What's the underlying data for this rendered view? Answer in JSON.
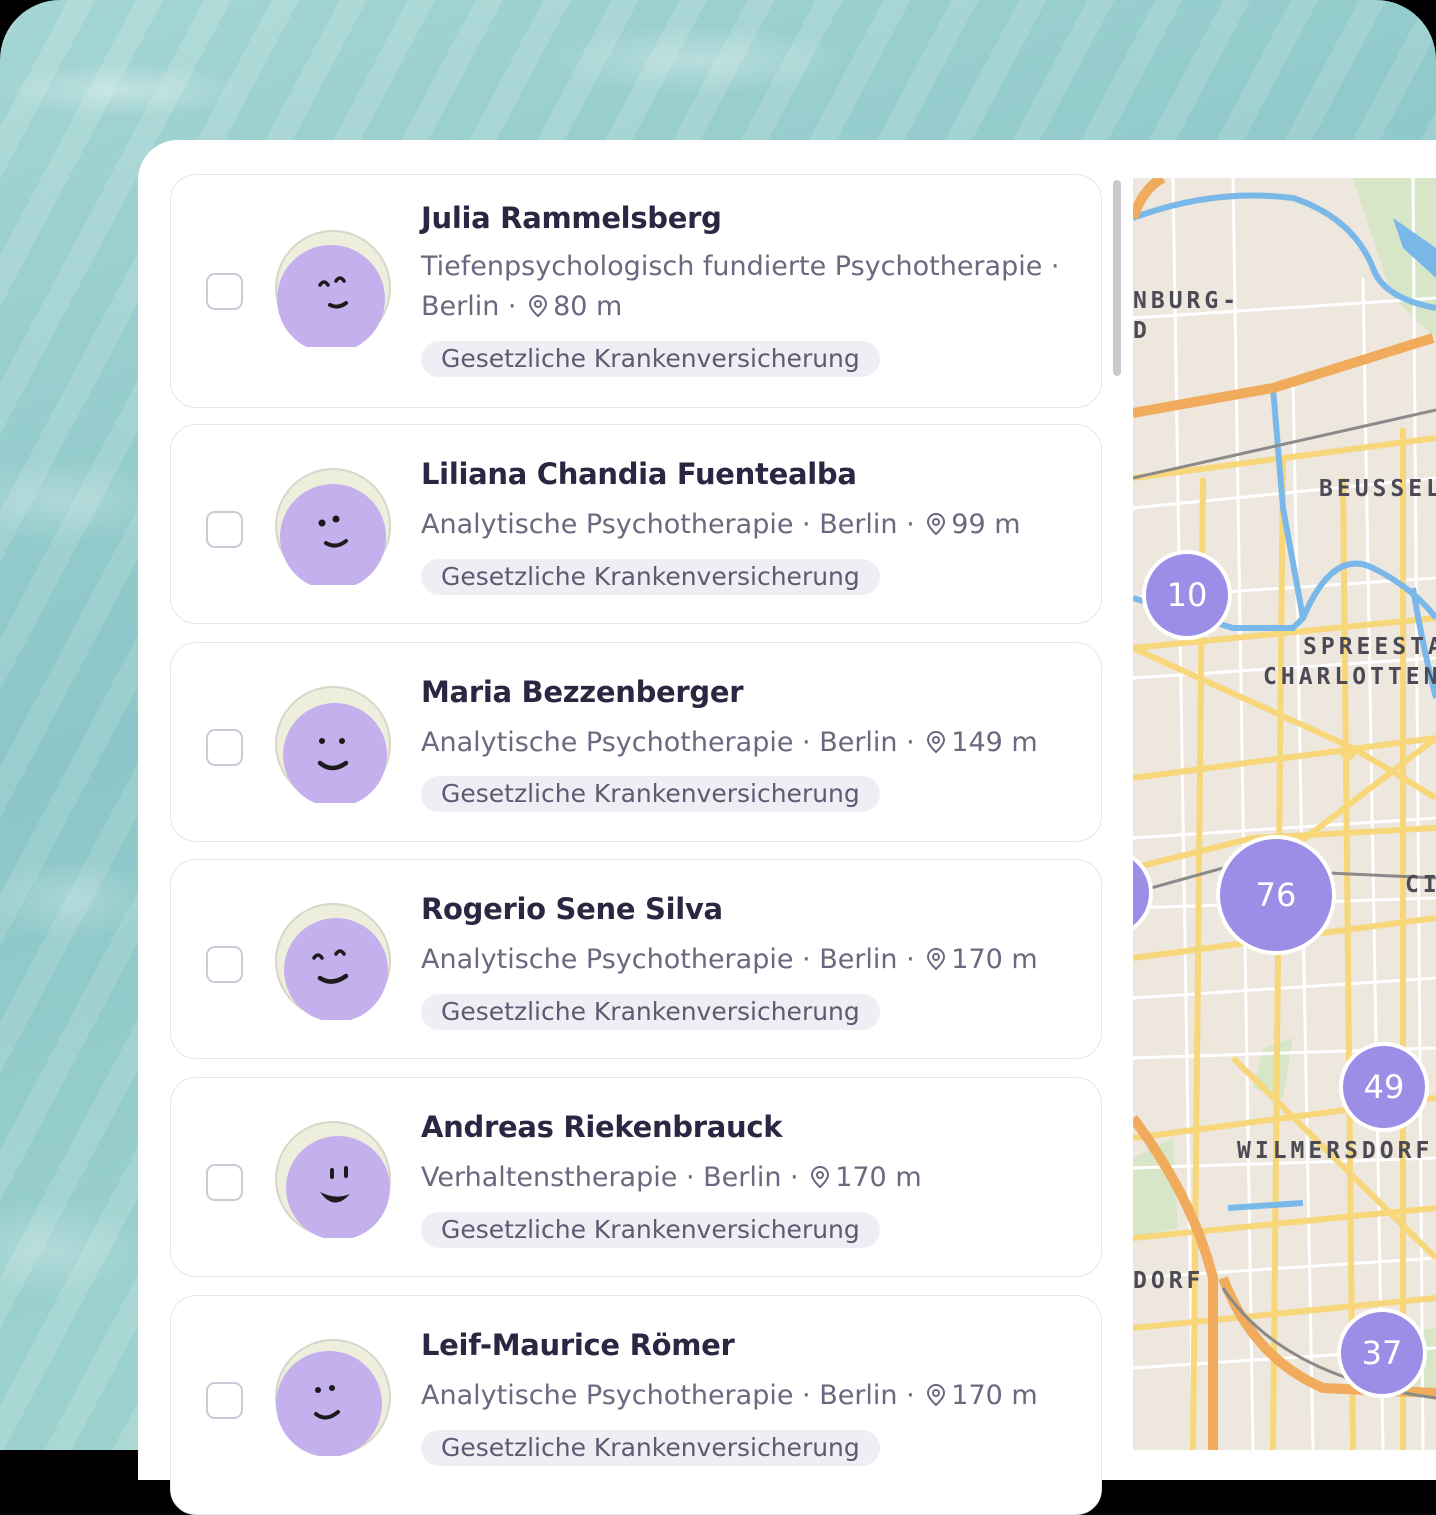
{
  "therapists": [
    {
      "name": "Julia Rammelsberg",
      "meta_line1": "Tiefenpsychologisch fundierte Psychotherapie ·",
      "city": "Berlin · ",
      "distance": "80 m",
      "insurance": "Gesetzliche Krankenversicherung"
    },
    {
      "name": "Liliana Chandia Fuentealba",
      "method": "Analytische Psychotherapie · Berlin · ",
      "distance": "99 m",
      "insurance": "Gesetzliche Krankenversicherung"
    },
    {
      "name": "Maria Bezzenberger",
      "method": "Analytische Psychotherapie · Berlin · ",
      "distance": "149 m",
      "insurance": "Gesetzliche Krankenversicherung"
    },
    {
      "name": "Rogerio Sene Silva",
      "method": "Analytische Psychotherapie · Berlin · ",
      "distance": "170 m",
      "insurance": "Gesetzliche Krankenversicherung"
    },
    {
      "name": "Andreas Riekenbrauck",
      "method": "Verhaltenstherapie · Berlin · ",
      "distance": "170 m",
      "insurance": "Gesetzliche Krankenversicherung"
    },
    {
      "name": "Leif-Maurice Römer",
      "method": "Analytische Psychotherapie · Berlin · ",
      "distance": "170 m",
      "insurance": "Gesetzliche Krankenversicherung"
    }
  ],
  "map": {
    "labels": [
      "NBURG-",
      "D",
      "BEUSSEL",
      "SPREESTA",
      "CHARLOTTEN",
      "CI",
      "WILMERSDORF",
      "DORF"
    ],
    "clusters": [
      "10",
      "76",
      "49",
      "37"
    ]
  },
  "colors": {
    "accent": "#9c8ee6",
    "avatar": "#c4b0ec",
    "text_primary": "#2a2742",
    "text_secondary": "#6b6880"
  }
}
